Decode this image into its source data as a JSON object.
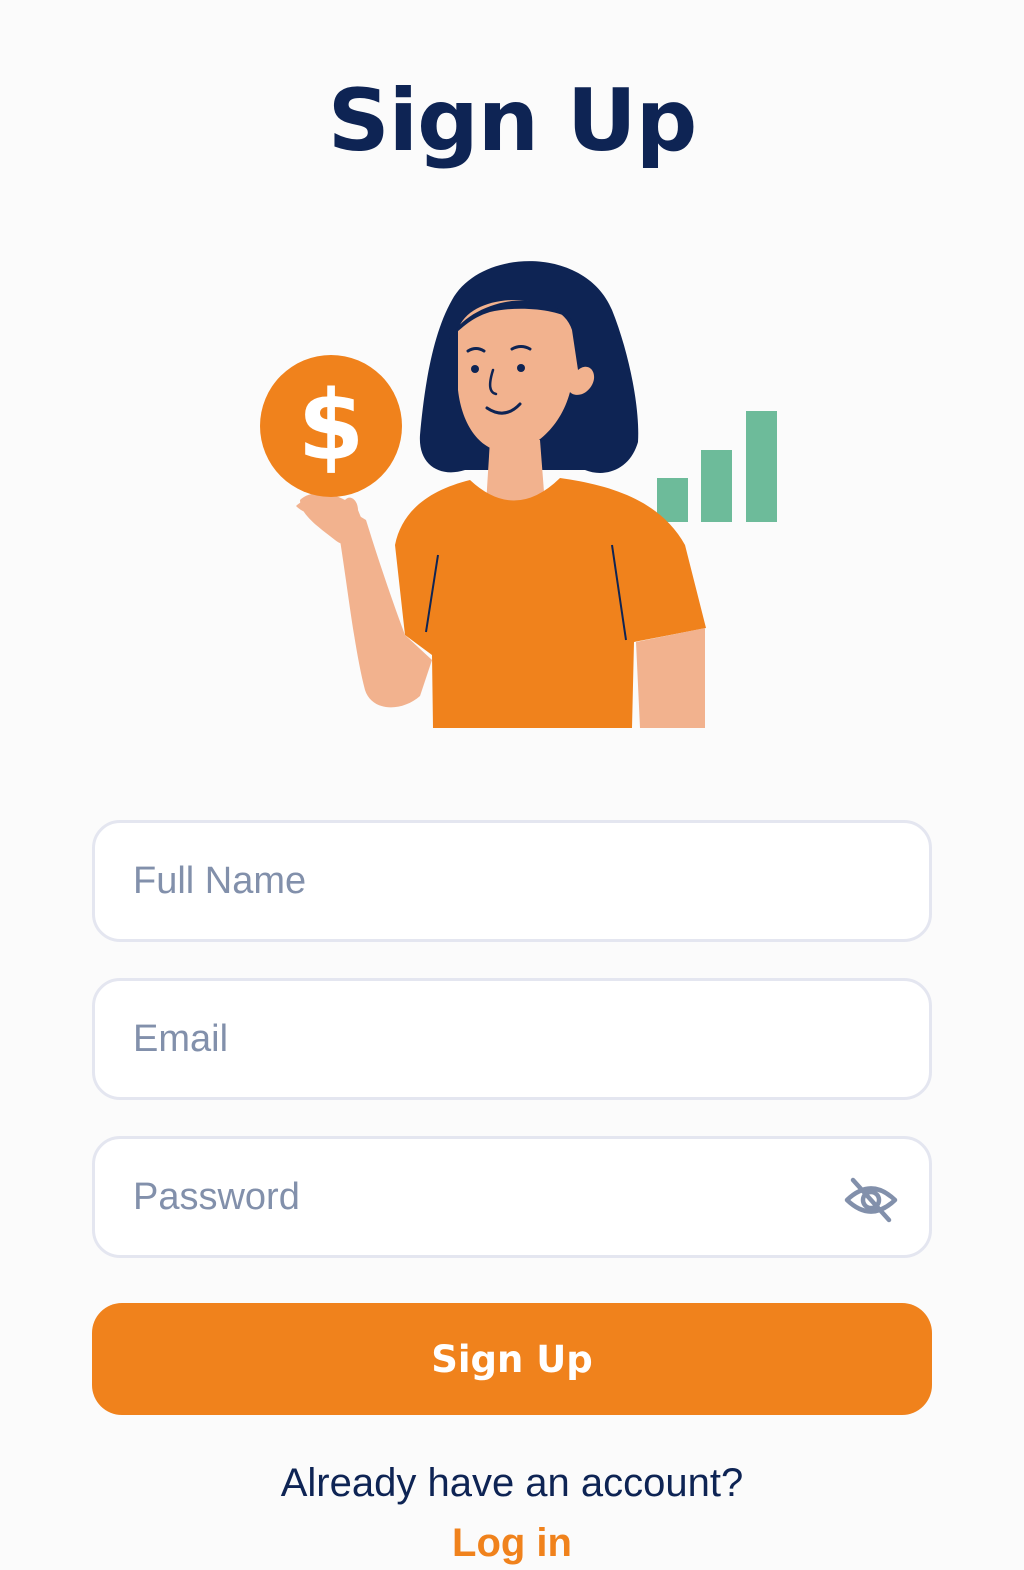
{
  "header": {
    "title": "Sign Up"
  },
  "illustration": {
    "coin_symbol": "$",
    "icon": "woman-holding-coin-illustration",
    "colors": {
      "coin": "#f0821c",
      "shirt": "#f0821c",
      "hair": "#0e2454",
      "skin": "#f2b28e",
      "bars": "#6dbb9a"
    }
  },
  "form": {
    "full_name": {
      "placeholder": "Full Name",
      "value": ""
    },
    "email": {
      "placeholder": "Email",
      "value": ""
    },
    "password": {
      "placeholder": "Password",
      "value": "",
      "toggle_icon": "eye-off-icon"
    },
    "submit_label": "Sign Up"
  },
  "footer": {
    "prompt": "Already have an account?",
    "login_label": "Log in"
  },
  "colors": {
    "accent": "#f0821c",
    "heading": "#0e2454",
    "placeholder": "#8290ab",
    "field_border": "#e4e6f0",
    "background": "#fbfbfb"
  }
}
